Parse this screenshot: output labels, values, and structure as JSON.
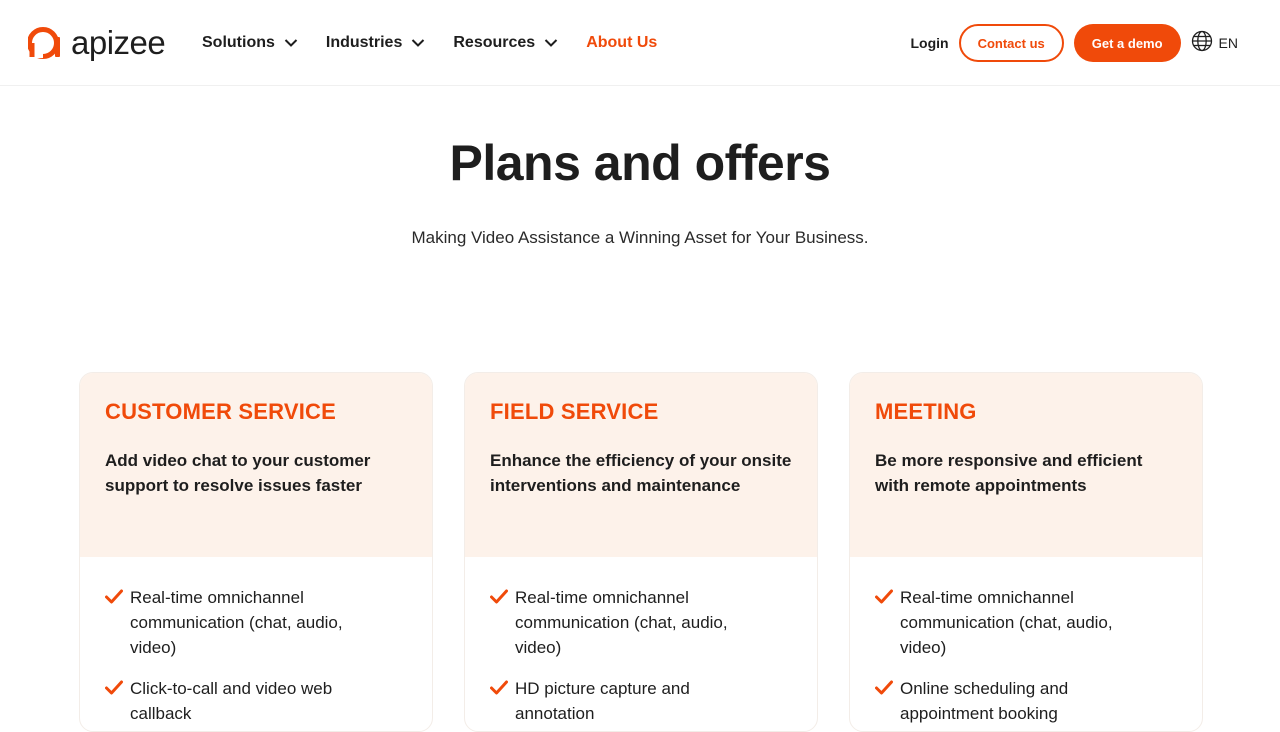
{
  "brand": {
    "name": "apizee",
    "accent": "#f04a0a"
  },
  "nav": {
    "items": [
      {
        "label": "Solutions",
        "dropdown": true,
        "active": false
      },
      {
        "label": "Industries",
        "dropdown": true,
        "active": false
      },
      {
        "label": "Resources",
        "dropdown": true,
        "active": false
      },
      {
        "label": "About Us",
        "dropdown": false,
        "active": true
      }
    ],
    "login": "Login",
    "contact": "Contact us",
    "demo": "Get a demo",
    "language": "EN",
    "language_icon": "globe-icon"
  },
  "hero": {
    "title": "Plans and offers",
    "subtitle": "Making Video Assistance a Winning Asset for Your Business."
  },
  "plans": [
    {
      "title": "CUSTOMER SERVICE",
      "description": "Add video chat to your customer support to resolve issues faster",
      "features": [
        "Real-time omnichannel communication (chat, audio, video)",
        "Click-to-call and video web callback"
      ]
    },
    {
      "title": "FIELD SERVICE",
      "description": "Enhance the efficiency of your onsite interventions and maintenance",
      "features": [
        "Real-time omnichannel communication (chat, audio, video)",
        "HD picture capture and annotation"
      ]
    },
    {
      "title": "MEETING",
      "description": "Be more responsive and efficient with remote appointments",
      "features": [
        "Real-time omnichannel communication (chat, audio, video)",
        "Online scheduling and appointment booking"
      ]
    }
  ]
}
